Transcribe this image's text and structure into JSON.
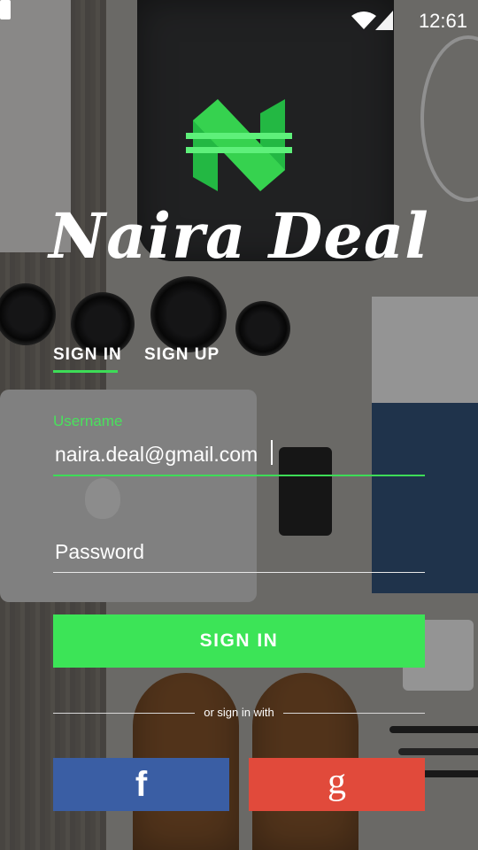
{
  "status_bar": {
    "time": "12:61"
  },
  "brand": {
    "name": "Naira Deal",
    "logo_icon": "naira-n-logo-icon",
    "accent_color": "#3ddc57"
  },
  "tabs": [
    {
      "label": "SIGN IN",
      "active": true
    },
    {
      "label": "SIGN UP",
      "active": false
    }
  ],
  "form": {
    "username_label": "Username",
    "username_value": "naira.deal@gmail.com",
    "password_placeholder": "Password"
  },
  "actions": {
    "signin_label": "SIGN IN",
    "divider_text": "or sign in with",
    "facebook": {
      "glyph": "f",
      "icon": "facebook-icon",
      "color": "#3a5ea4"
    },
    "google": {
      "glyph": "g",
      "icon": "google-icon",
      "color": "#e14a3b"
    }
  }
}
